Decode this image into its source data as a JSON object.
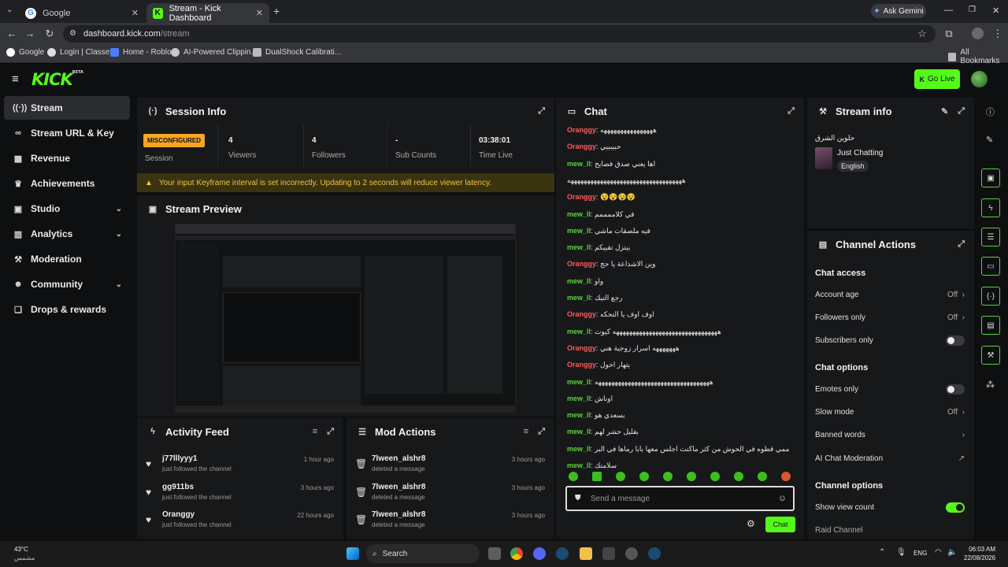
{
  "browser": {
    "tabs": [
      {
        "title": "Google",
        "active": false
      },
      {
        "title": "Stream - Kick Dashboard",
        "active": true
      }
    ],
    "ask_gemini": "Ask Gemini",
    "url_domain": "dashboard.kick.com",
    "url_path": "/stream",
    "bookmarks": [
      "Google",
      "Login | Classera",
      "Home - Roblox",
      "AI-Powered Clippin...",
      "DualShock Calibrati..."
    ],
    "all_bookmarks": "All Bookmarks"
  },
  "app": {
    "logo": "KICK",
    "logo_sup": "BETA",
    "go_live": "Go Live"
  },
  "sidebar": {
    "items": [
      {
        "label": "Stream",
        "icon": "broadcast-icon"
      },
      {
        "label": "Stream URL & Key",
        "icon": "link-icon"
      },
      {
        "label": "Revenue",
        "icon": "revenue-icon"
      },
      {
        "label": "Achievements",
        "icon": "trophy-icon"
      },
      {
        "label": "Studio",
        "icon": "studio-icon"
      },
      {
        "label": "Analytics",
        "icon": "chart-icon"
      },
      {
        "label": "Moderation",
        "icon": "wrench-icon"
      },
      {
        "label": "Community",
        "icon": "community-icon"
      },
      {
        "label": "Drops & rewards",
        "icon": "gift-icon"
      }
    ]
  },
  "session": {
    "title": "Session Info",
    "status": "MISCONFIGURED",
    "status_label": "Session",
    "viewers": "4",
    "viewers_label": "Viewers",
    "followers": "4",
    "followers_label": "Followers",
    "subs": "-",
    "subs_label": "Sub Counts",
    "time": "03:38:01",
    "time_label": "Time Live",
    "warning": "Your input Keyframe interval is set incorrectly. Updating to 2 seconds will reduce viewer latency."
  },
  "preview": {
    "title": "Stream Preview"
  },
  "activity": {
    "title": "Activity Feed",
    "rows": [
      {
        "name": "j77lllyyy1",
        "sub": "just followed the channel",
        "time": "1 hour ago"
      },
      {
        "name": "gg911bs",
        "sub": "just followed the channel",
        "time": "3 hours ago"
      },
      {
        "name": "Oranggy",
        "sub": "just followed the channel",
        "time": "22 hours ago"
      }
    ]
  },
  "mod": {
    "title": "Mod Actions",
    "rows": [
      {
        "name": "7lween_alshr8",
        "sub": "deleted a message",
        "time": "3 hours ago"
      },
      {
        "name": "7lween_alshr8",
        "sub": "deleted a message",
        "time": "3 hours ago"
      },
      {
        "name": "7lween_alshr8",
        "sub": "deleted a message",
        "time": "3 hours ago"
      }
    ]
  },
  "chat": {
    "title": "Chat",
    "colors": {
      "orange": "#ff5a5a",
      "green": "#5ad43a"
    },
    "messages": [
      {
        "user": "Oranggy",
        "color": "orange",
        "text": "ههههههههههههههههه"
      },
      {
        "user": "Oranggy",
        "color": "orange",
        "text": "حبيبييي"
      },
      {
        "user": "mew_ll",
        "color": "green",
        "text": "اها يعني صدق فضايح"
      },
      {
        "user": "",
        "color": "green",
        "text": "هههههههههههههههههههههههههههههههههههه"
      },
      {
        "user": "Oranggy",
        "color": "orange",
        "text": "😵😵😵😵"
      },
      {
        "user": "mew_ll",
        "color": "green",
        "text": "في كلاممممم"
      },
      {
        "user": "mew_ll",
        "color": "green",
        "text": "فيه ملصقات ماشي"
      },
      {
        "user": "mew_ll",
        "color": "green",
        "text": "بيتزل تقييكم"
      },
      {
        "user": "Oranggy",
        "color": "orange",
        "text": "وين الاشداعة يا حج"
      },
      {
        "user": "mew_ll",
        "color": "green",
        "text": "واو"
      },
      {
        "user": "mew_ll",
        "color": "green",
        "text": "رجع التيك"
      },
      {
        "user": "Oranggy",
        "color": "orange",
        "text": "اوف اوف يا التحكه"
      },
      {
        "user": "mew_ll",
        "color": "green",
        "text": "ههههههههههههههههههههههههههههههههه كيوت"
      },
      {
        "user": "Oranggy",
        "color": "orange",
        "text": "هههههههه اسرار زوجية هني"
      },
      {
        "user": "Oranggy",
        "color": "orange",
        "text": "يتهار احول"
      },
      {
        "user": "mew_ll",
        "color": "green",
        "text": "هههههههههههههههههههههههههههههههههههه"
      },
      {
        "user": "mew_ll",
        "color": "green",
        "text": "اوناش"
      },
      {
        "user": "mew_ll",
        "color": "green",
        "text": "يسعدي هو"
      },
      {
        "user": "mew_ll",
        "color": "green",
        "text": "بقليل حشر لهم"
      },
      {
        "user": "mew_ll",
        "color": "green",
        "text": "كان ممي قطوه في الحوش من كثر ماكنت اجلس معها بابا رماها في البر"
      },
      {
        "user": "mew_ll",
        "color": "green",
        "text": "سلامتك"
      }
    ],
    "input_placeholder": "Send a message",
    "send_label": "Chat"
  },
  "stream_info": {
    "title": "Stream info",
    "stream_title": "حلوين الشرق",
    "category": "Just Chatting",
    "language": "English"
  },
  "channel_actions": {
    "title": "Channel Actions",
    "chat_access_title": "Chat access",
    "account_age": "Account age",
    "account_age_val": "Off",
    "followers_only": "Followers only",
    "followers_only_val": "Off",
    "subscribers_only": "Subscribers only",
    "chat_options_title": "Chat options",
    "emotes_only": "Emotes only",
    "slow_mode": "Slow mode",
    "slow_mode_val": "Off",
    "banned_words": "Banned words",
    "ai_moderation": "AI Chat Moderation",
    "channel_options_title": "Channel options",
    "show_view_count": "Show view count",
    "raid_channel": "Raid Channel"
  },
  "taskbar": {
    "weather_temp": "43°C",
    "weather_desc": "مشمس",
    "search": "Search",
    "lang": "ENG",
    "time": "06:03 AM",
    "date": "22/08/2026"
  }
}
